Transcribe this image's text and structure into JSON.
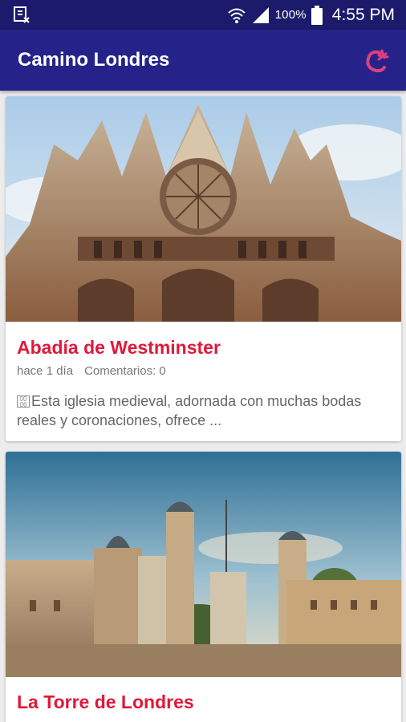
{
  "status_bar": {
    "left_icon": "screen-record-icon",
    "battery_text": "100%",
    "time": "4:55 PM",
    "icons": [
      "wifi-icon",
      "signal-icon",
      "battery-icon"
    ]
  },
  "app_bar": {
    "title": "Camino Londres",
    "action_icon": "app-logo-icon",
    "accent_color": "#e0193a",
    "bar_color": "#25238a"
  },
  "posts": [
    {
      "title": "Abadía de Westminster",
      "date": "hace 1 día",
      "comments": "Comentarios: 0",
      "excerpt": "Esta iglesia medieval, adornada con muchas bodas reales y coronaciones, ofrece  ...",
      "image_icon": "westminster-abbey-photo"
    },
    {
      "title": "La Torre de Londres",
      "image_icon": "tower-of-london-photo"
    }
  ]
}
